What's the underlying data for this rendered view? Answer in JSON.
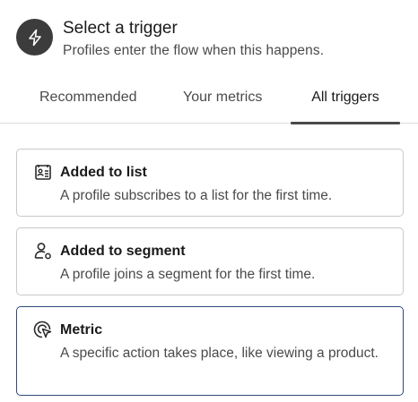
{
  "header": {
    "title": "Select a trigger",
    "subtitle": "Profiles enter the flow when this happens.",
    "icon": "lightning-icon"
  },
  "tabs": [
    {
      "label": "Recommended",
      "active": false
    },
    {
      "label": "Your metrics",
      "active": false
    },
    {
      "label": "All triggers",
      "active": true
    }
  ],
  "triggers": [
    {
      "title": "Added to list",
      "description": "A profile subscribes to a list for the first time.",
      "icon": "list-icon",
      "selected": false
    },
    {
      "title": "Added to segment",
      "description": "A profile joins a segment for the first time.",
      "icon": "user-segment-icon",
      "selected": false
    },
    {
      "title": "Metric",
      "description": "A specific action takes place, like viewing a product.",
      "icon": "metric-cursor-icon",
      "selected": true
    }
  ],
  "colors": {
    "selected_border": "#2f4a7a",
    "tab_indicator": "#4a4a4a"
  }
}
